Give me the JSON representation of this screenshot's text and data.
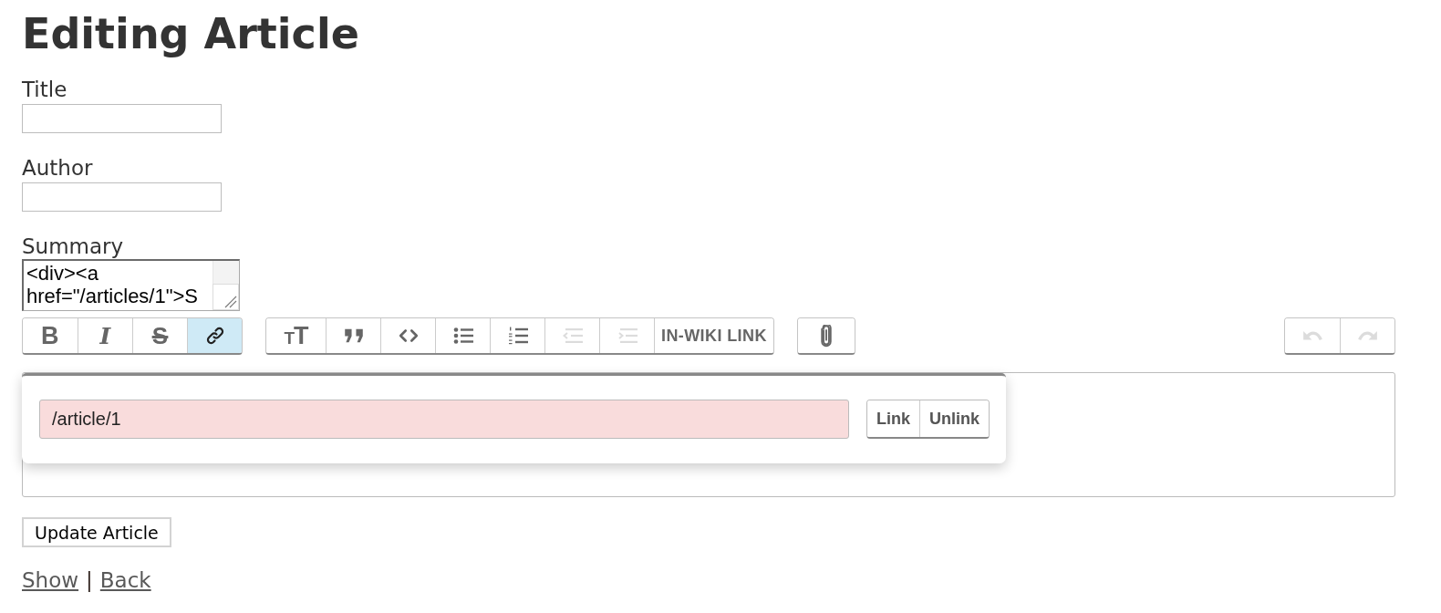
{
  "page": {
    "heading": "Editing Article"
  },
  "fields": [
    {
      "label": "Title",
      "kind": "input"
    },
    {
      "label": "Author",
      "kind": "input"
    },
    {
      "label": "Summary",
      "kind": "textarea",
      "value": "<div><a href=\"/articles/1\">S"
    }
  ],
  "toolbar": {
    "groups": [
      {
        "buttons": [
          {
            "kind": "bold",
            "glyph": "B",
            "active": false,
            "disabled": false
          },
          {
            "kind": "italic",
            "glyph": "I",
            "active": false,
            "disabled": false
          },
          {
            "kind": "strike",
            "glyph": "S",
            "active": false,
            "disabled": false
          },
          {
            "kind": "link",
            "active": true,
            "disabled": false
          }
        ]
      },
      {
        "buttons": [
          {
            "kind": "heading",
            "glyph": "TT",
            "active": false,
            "disabled": false
          },
          {
            "kind": "quote",
            "active": false,
            "disabled": false
          },
          {
            "kind": "code",
            "active": false,
            "disabled": false
          },
          {
            "kind": "bullets",
            "active": false,
            "disabled": false
          },
          {
            "kind": "numbers",
            "active": false,
            "disabled": false
          },
          {
            "kind": "outdent",
            "active": false,
            "disabled": true
          },
          {
            "kind": "indent",
            "active": false,
            "disabled": true
          },
          {
            "kind": "text",
            "label": "IN-WIKI LINK",
            "active": false,
            "disabled": false
          }
        ]
      },
      {
        "buttons": [
          {
            "kind": "attach",
            "active": false,
            "disabled": false
          }
        ]
      },
      {
        "buttons": [
          {
            "kind": "undo",
            "active": false,
            "disabled": true
          },
          {
            "kind": "redo",
            "active": false,
            "disabled": true
          }
        ]
      }
    ]
  },
  "link_dialog": {
    "url": "/article/1",
    "invalid": true,
    "buttons": [
      "Link",
      "Unlink"
    ]
  },
  "submit": {
    "label": "Update Article"
  },
  "links": {
    "items": [
      {
        "label": "Show"
      },
      {
        "label": "Back"
      }
    ],
    "separator": "|"
  }
}
